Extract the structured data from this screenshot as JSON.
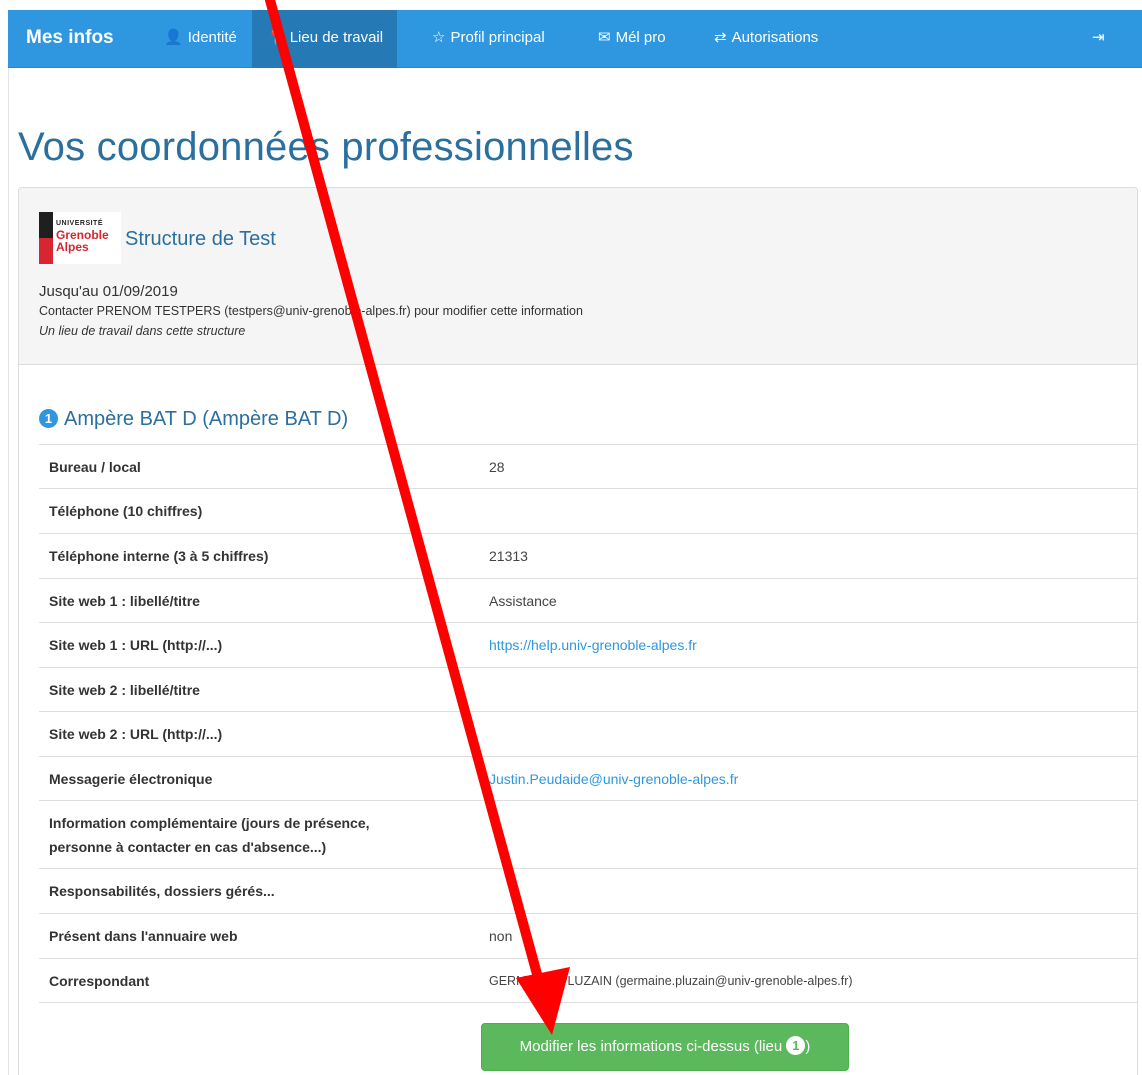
{
  "nav": {
    "brand": "Mes infos",
    "items": [
      {
        "label": "Identité",
        "icon": "user-icon",
        "glyph": "👤",
        "active": false
      },
      {
        "label": "Lieu de travail",
        "icon": "map-marker-icon",
        "glyph": "📍",
        "active": true
      },
      {
        "label": "Profil principal",
        "icon": "star-icon",
        "glyph": "☆",
        "active": false
      },
      {
        "label": "Mél pro",
        "icon": "envelope-icon",
        "glyph": "✉",
        "active": false
      },
      {
        "label": "Autorisations",
        "icon": "transfer-icon",
        "glyph": "⇄",
        "active": false
      }
    ],
    "logout_icon": "logout-icon",
    "logout_glyph": "⇥"
  },
  "page": {
    "title": "Vos coordonnées professionnelles"
  },
  "structure": {
    "logo_line1": "UNIVERSITÉ",
    "logo_line2": "Grenoble",
    "logo_line3": "Alpes",
    "name": "Structure de Test",
    "until": "Jusqu'au 01/09/2019",
    "contact": "Contacter PRENOM TESTPERS (testpers@univ-grenoble-alpes.fr) pour modifier cette information",
    "note": "Un lieu de travail dans cette structure"
  },
  "lieu": {
    "number": "1",
    "title": "Ampère BAT D (Ampère BAT D)",
    "rows": [
      {
        "label": "Bureau / local",
        "value": "28"
      },
      {
        "label": "Téléphone (10 chiffres)",
        "value": ""
      },
      {
        "label": "Téléphone interne (3 à 5 chiffres)",
        "value": "21313"
      },
      {
        "label": "Site web 1 : libellé/titre",
        "value": "Assistance"
      },
      {
        "label": "Site web 1 : URL (http://...)",
        "value": "https://help.univ-grenoble-alpes.fr"
      },
      {
        "label": "Site web 2 : libellé/titre",
        "value": ""
      },
      {
        "label": "Site web 2 : URL (http://...)",
        "value": ""
      },
      {
        "label": "Messagerie électronique",
        "value": "Justin.Peudaide@univ-grenoble-alpes.fr"
      },
      {
        "label": "Information complémentaire (jours de présence,",
        "label2": "personne à contacter en cas d'absence...)",
        "value": ""
      },
      {
        "label": "Responsabilités, dossiers gérés...",
        "value": ""
      },
      {
        "label": "Présent dans l'annuaire web",
        "value": "non"
      },
      {
        "label": "Correspondant",
        "value": "GERMAINE PLUZAIN (germaine.pluzain@univ-grenoble-alpes.fr)"
      }
    ]
  },
  "button": {
    "label": "Modifier les informations ci-dessus (lieu ",
    "badge": "1",
    "suffix": ")"
  },
  "annotation": {
    "arrow_color": "#ff0000"
  }
}
